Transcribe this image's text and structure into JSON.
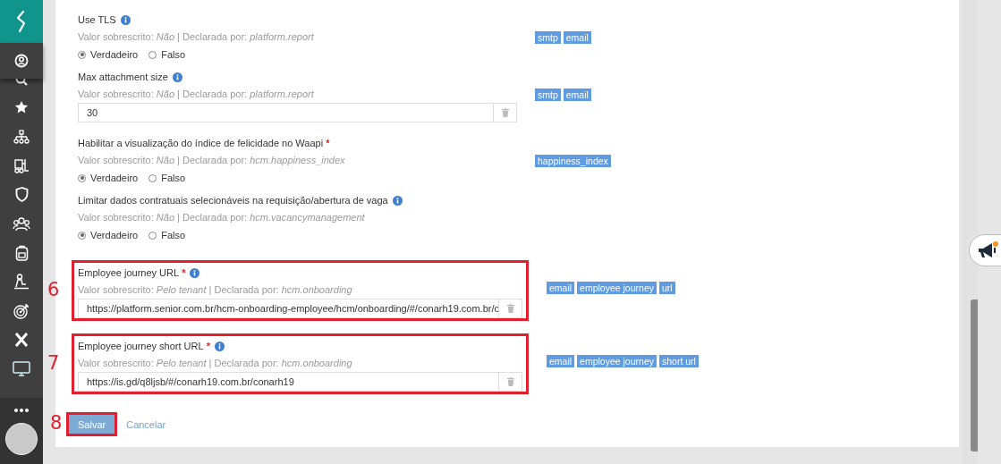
{
  "settings": [
    {
      "kind": "boolean",
      "label": "Use TLS",
      "info": true,
      "meta": "Valor sobrescrito: *Não* | Declarada por: *platform.report*",
      "options": [
        {
          "label": "Verdadeiro",
          "selected": true
        },
        {
          "label": "Falso",
          "selected": false
        }
      ],
      "tags": [
        "smtp",
        "email"
      ]
    },
    {
      "kind": "text",
      "label": "Max attachment size",
      "info": true,
      "meta": "Valor sobrescrito: *Não* | Declarada por: *platform.report*",
      "value": "30",
      "tags": [
        "smtp",
        "email"
      ]
    },
    {
      "kind": "boolean",
      "label": "Habilitar a visualização do índice de felicidade no Waapi",
      "required_mark": "*",
      "info": false,
      "meta": "Valor sobrescrito: *Não* | Declarada por: *hcm.happiness_index*",
      "options": [
        {
          "label": "Verdadeiro",
          "selected": true
        },
        {
          "label": "Falso",
          "selected": false
        }
      ],
      "tags": [
        "happiness_index"
      ]
    },
    {
      "kind": "boolean",
      "label": "Limitar dados contratuais selecionáveis na requisição/abertura de vaga",
      "info": true,
      "meta": "Valor sobrescrito: *Não* | Declarada por: *hcm.vacancymanagement*",
      "options": [
        {
          "label": "Verdadeiro",
          "selected": true
        },
        {
          "label": "Falso",
          "selected": false
        }
      ]
    },
    {
      "kind": "text",
      "label": "Employee journey URL",
      "required_mark": "*",
      "info": true,
      "meta": "Valor sobrescrito: *Pelo tenant* | Declarada por: *hcm.onboarding*",
      "value": "https://platform.senior.com.br/hcm-onboarding-employee/hcm/onboarding/#/conarh19.com.br/c",
      "tags": [
        "email",
        "employee journey",
        "url"
      ],
      "annotation": "6"
    },
    {
      "kind": "text",
      "label": "Employee journey short URL",
      "required_mark": "*",
      "info": true,
      "meta": "Valor sobrescrito: *Pelo tenant* | Declarada por: *hcm.onboarding*",
      "value": "https://is.gd/q8ljsb/#/conarh19.com.br/conarh19",
      "tags": [
        "email",
        "employee journey",
        "short url"
      ],
      "annotation": "7"
    }
  ],
  "buttons": [
    {
      "kind": "primary",
      "label": "Salvar",
      "annotation": "8"
    },
    {
      "kind": "link",
      "label": "Cancelar"
    }
  ]
}
